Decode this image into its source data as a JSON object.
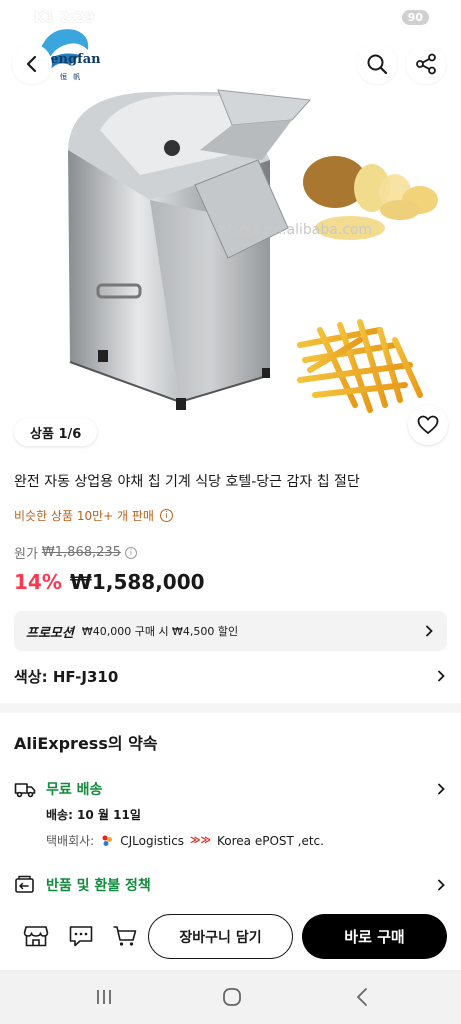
{
  "status_bar": {
    "time": "K1 2:29",
    "battery": "90"
  },
  "brand_logo": {
    "name": "Hengfan",
    "sub": "恒 帆"
  },
  "header": {
    "back_icon": "chevron-left-icon",
    "search_icon": "search-icon",
    "share_icon": "share-icon"
  },
  "gallery": {
    "watermark": "hfspjx.en.alibaba.com",
    "page_indicator": "상품 1/6",
    "wishlist_icon": "heart-icon"
  },
  "product": {
    "title": "완전 자동 상업용 야채 칩 기계 식당 호텔-당근 감자 칩 절단",
    "sold_text": "비슷한 상품 10만+ 개 판매",
    "original_label": "원가",
    "original_price": "₩1,868,235",
    "discount": "14%",
    "price": "₩1,588,000",
    "accent_color": "#fd384f"
  },
  "promotion": {
    "label": "프로모션",
    "text": "₩40,000 구매 시 ₩4,500 할인"
  },
  "variant": {
    "label": "색상: HF-J310"
  },
  "promise": {
    "title": "AliExpress의 약속",
    "shipping": {
      "label": "무료 배송",
      "date": "배송: 10 월 11일",
      "carrier_label": "택배회사:",
      "carrier_1": "CJLogistics",
      "carrier_2": "Korea ePOST ,etc."
    },
    "returns": {
      "label": "반품 및 환불 정책"
    },
    "green_color": "#138b3e"
  },
  "actions": {
    "add_to_cart": "장바구니 담기",
    "buy_now": "바로 구매"
  }
}
